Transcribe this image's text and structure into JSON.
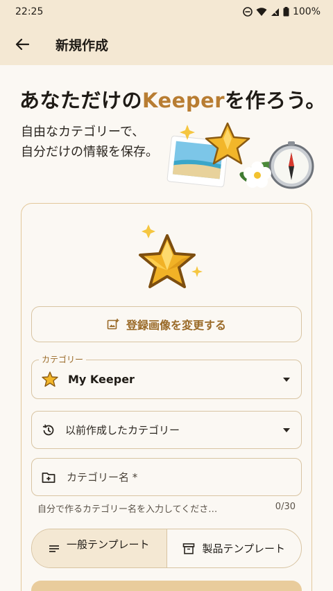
{
  "status_bar": {
    "time": "22:25",
    "battery": "100%",
    "icons": [
      "do-not-disturb-icon",
      "wifi-icon",
      "signal-icon",
      "battery-icon"
    ]
  },
  "app_bar": {
    "title": "新規作成",
    "back_icon": "arrow-left-icon"
  },
  "hero": {
    "title_pre": "あなただけの",
    "title_accent": "Keeper",
    "title_post": "を作ろう。",
    "subtitle_line1": "自由なカテゴリーで、",
    "subtitle_line2": "自分だけの情報を保存。"
  },
  "form": {
    "change_image_label": "登録画像を変更する",
    "category": {
      "label": "カテゴリー",
      "value": "My Keeper"
    },
    "previous_category": {
      "value": "以前作成したカテゴリー"
    },
    "category_name": {
      "placeholder": "カテゴリー名 *"
    },
    "helper": {
      "text": "自分で作るカテゴリー名を入力してくださ…",
      "counter": "0/30"
    },
    "templates": [
      {
        "label": "一般テンプレート",
        "active": true
      },
      {
        "label": "製品テンプレート",
        "active": false
      }
    ]
  },
  "colors": {
    "accent": "#b87d32",
    "app_bar": "#f4e8d3",
    "border": "#d8c4a2"
  }
}
